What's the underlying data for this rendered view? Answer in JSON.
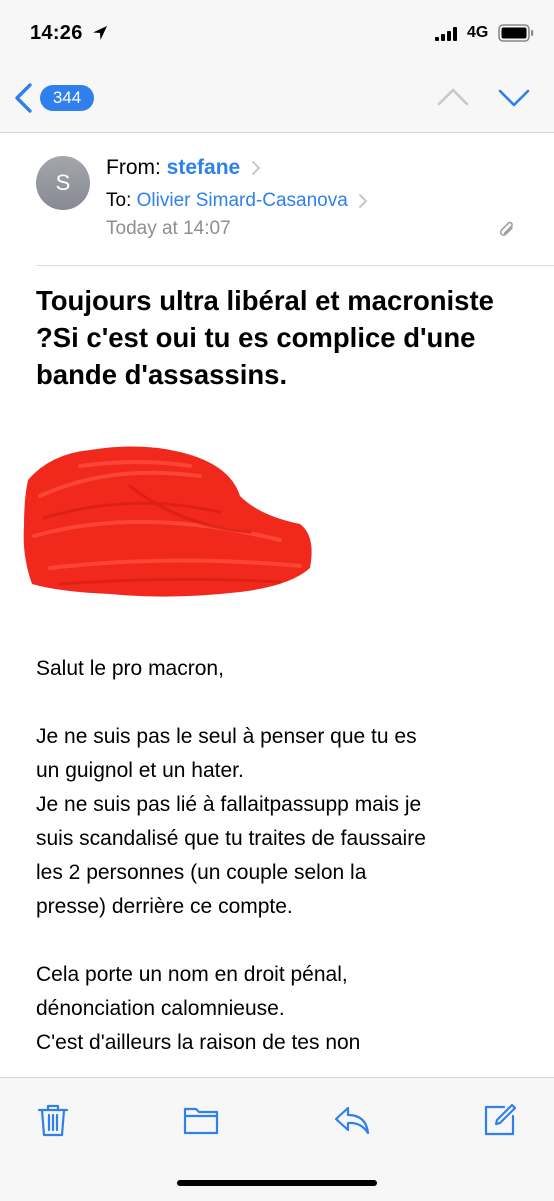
{
  "status_bar": {
    "time": "14:26",
    "network": "4G",
    "icons": [
      "location-arrow-icon",
      "signal-bars-icon",
      "battery-icon"
    ]
  },
  "nav": {
    "unread_count": "344",
    "icons": [
      "back-chevron-icon",
      "previous-message-icon",
      "next-message-icon"
    ]
  },
  "header": {
    "avatar_initial": "S",
    "from_label": "From:",
    "from_name": "stefane",
    "to_label": "To:",
    "to_name": "Olivier Simard-Casanova",
    "date": "Today at 14:07"
  },
  "subject": "Toujours ultra libéral et macroniste ?Si c'est oui tu es complice d'une bande d'assassins.",
  "body": {
    "lines": [
      "Salut le pro macron,",
      "",
      "Je ne suis pas le seul à penser que tu es",
      "un guignol et un hater.",
      "Je ne suis pas lié à fallaitpassupp mais je",
      "suis scandalisé que tu traites de faussaire",
      "les 2 personnes (un couple selon la",
      "presse) derrière ce compte.",
      "",
      "Cela porte un nom en droit pénal,",
      "dénonciation calomnieuse.",
      "C'est d'ailleurs la raison de tes non"
    ]
  },
  "colors": {
    "accent": "#2f80ed",
    "redaction": "#f0291c",
    "secondary_text": "#8e8e93",
    "bar_background": "#f7f7f7"
  },
  "toolbar": {
    "icons": [
      "trash-icon",
      "folder-icon",
      "reply-icon",
      "compose-icon"
    ]
  }
}
